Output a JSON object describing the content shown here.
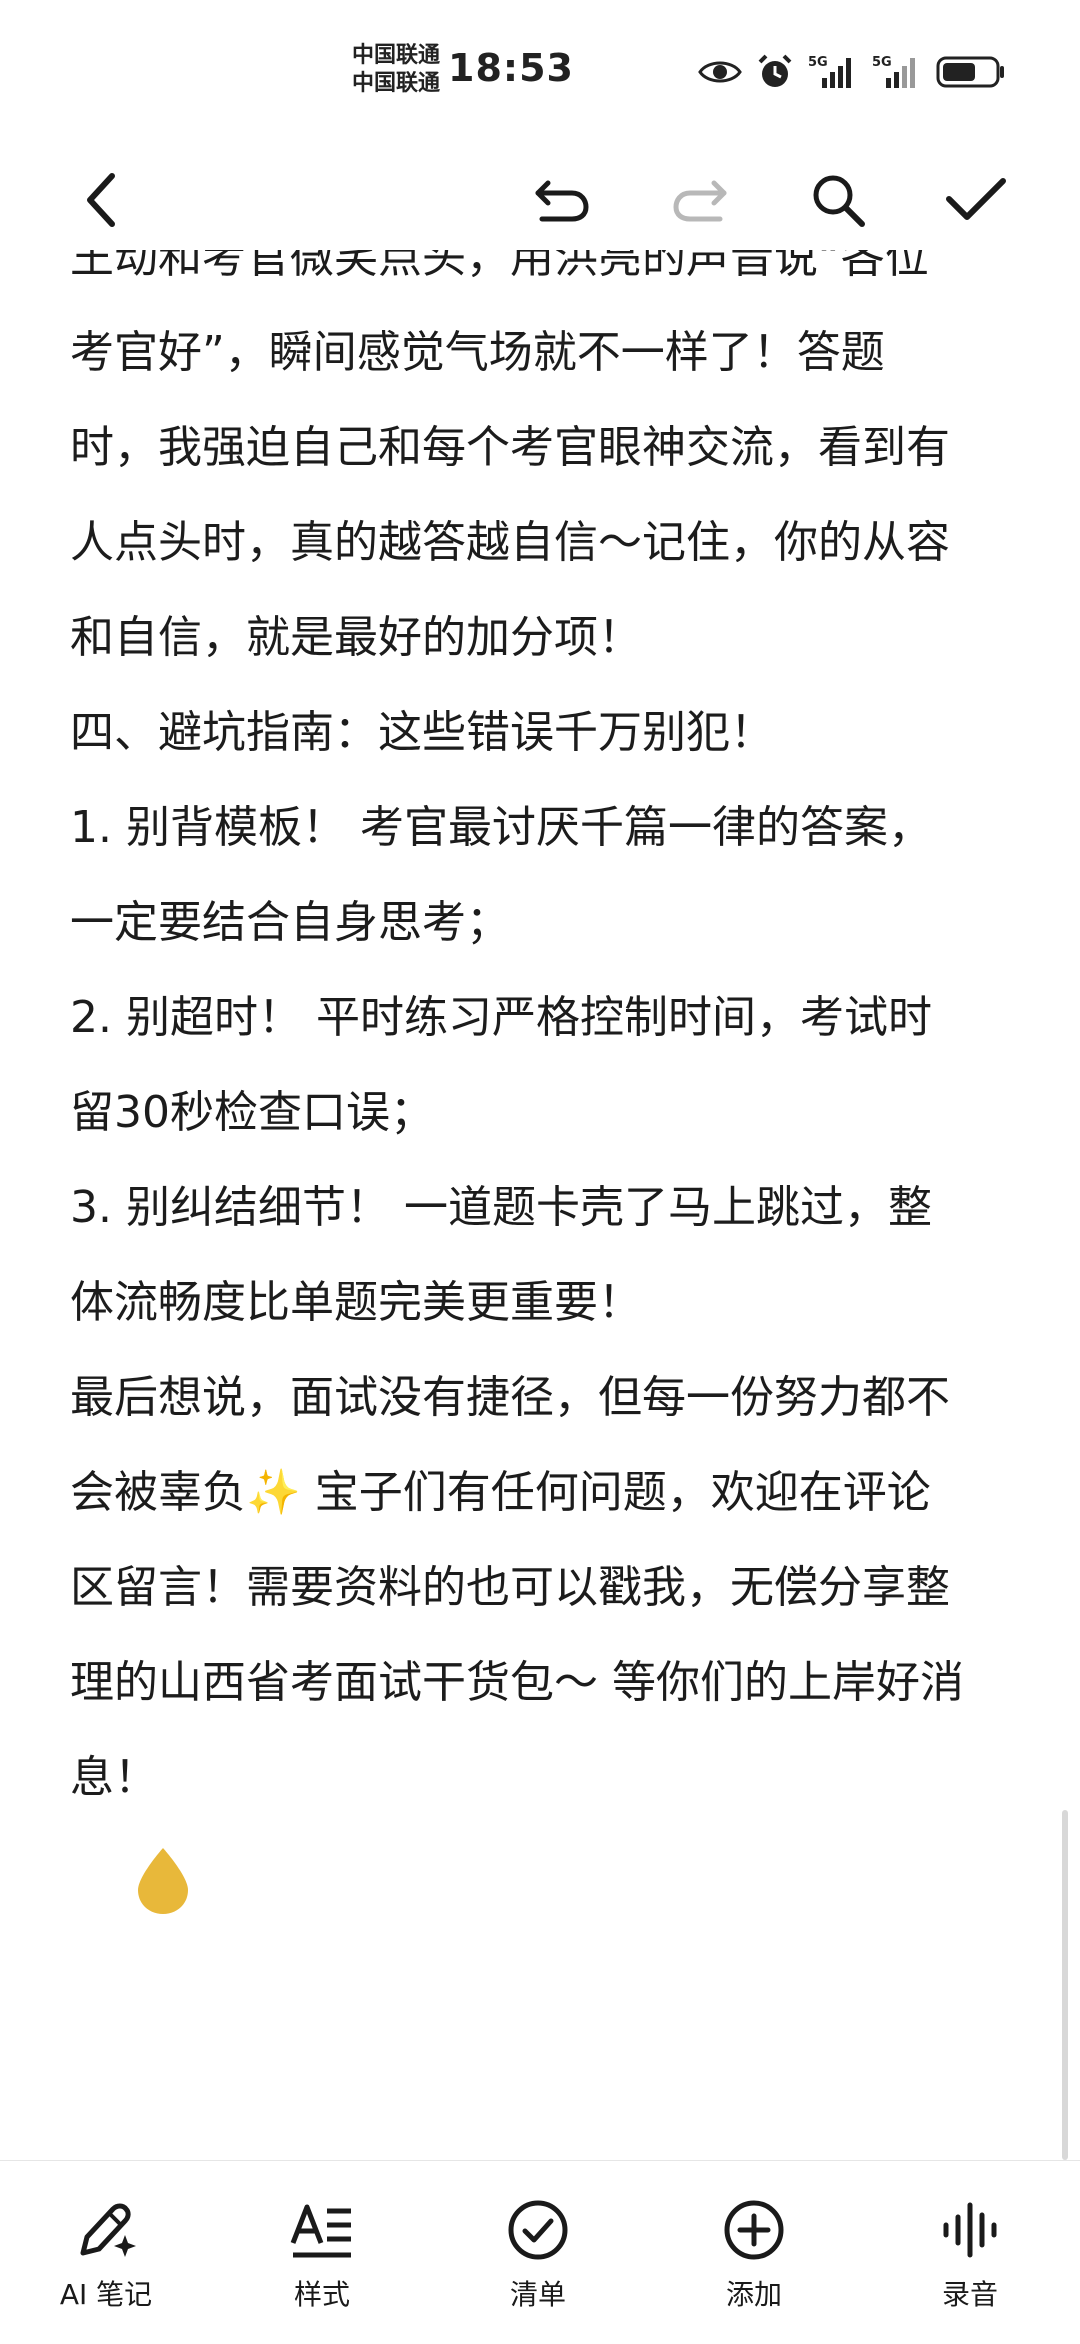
{
  "status_bar": {
    "carrier_1": "中国联通",
    "carrier_2": "中国联通",
    "time": "18:53",
    "network_1": "5G",
    "network_2": "5G",
    "icons": [
      "eye-icon",
      "alarm-icon",
      "signal-icon",
      "signal-icon",
      "battery-icon"
    ]
  },
  "toolbar": {
    "icons": [
      "back-arrow-icon",
      "undo-icon",
      "redo-icon",
      "search-icon",
      "check-icon"
    ]
  },
  "content": {
    "lines": [
      "王动和考官微笑点头，用洪亮的声音说“各位",
      "考官好”，瞬间感觉气场就不一样了！答题",
      "时，我强迫自己和每个考官眼神交流，看到有",
      "人点头时，真的越答越自信～记住，你的从容",
      "和自信，就是最好的加分项！",
      "四、避坑指南：这些错误千万别犯！",
      "1. 别背模板！ 考官最讨厌千篇一律的答案，",
      "一定要结合自身思考；",
      "2. 别超时！ 平时练习严格控制时间，考试时",
      "留30秒检查口误；",
      "3. 别纠结细节！ 一道题卡壳了马上跳过，整",
      "体流畅度比单题完美更重要！",
      "最后想说，面试没有捷径，但每一份努力都不",
      "会被辜负✨ 宝子们有任何问题，欢迎在评论",
      "区留言！需要资料的也可以戳我，无偿分享整",
      "理的山西省考面试干货包～ 等你们的上岸好消",
      "息！"
    ]
  },
  "bottom_bar": {
    "items": [
      {
        "label": "AI 笔记",
        "icon": "ai-pen-icon"
      },
      {
        "label": "样式",
        "icon": "text-style-icon"
      },
      {
        "label": "清单",
        "icon": "checklist-icon"
      },
      {
        "label": "添加",
        "icon": "add-icon"
      },
      {
        "label": "录音",
        "icon": "record-audio-icon"
      }
    ]
  },
  "colors": {
    "accent_handle": "#E8B83A",
    "redo_disabled": "#B8B8B8",
    "text": "#1C1C1C"
  }
}
